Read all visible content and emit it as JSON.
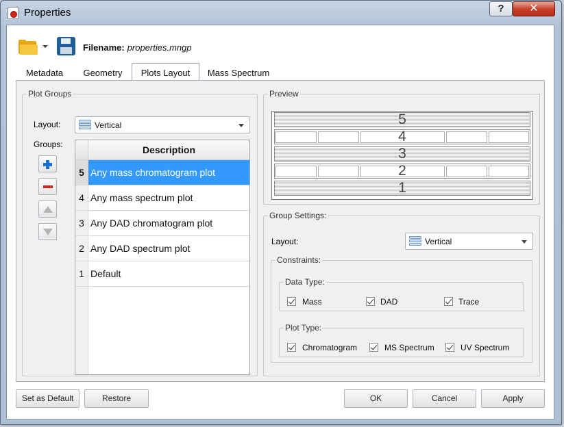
{
  "window": {
    "title": "Properties",
    "help_label": "?",
    "close_label": "✕"
  },
  "toolbar": {
    "open_icon": "folder-icon",
    "save_icon": "save-icon",
    "filename_label": "Filename:",
    "filename_value": "properties.mngp"
  },
  "tabs": [
    {
      "label": "Metadata"
    },
    {
      "label": "Geometry"
    },
    {
      "label": "Plots Layout",
      "active": true
    },
    {
      "label": "Mass Spectrum"
    }
  ],
  "plot_groups": {
    "title": "Plot Groups",
    "layout_label": "Layout:",
    "layout_value": "Vertical",
    "groups_label": "Groups:",
    "column_header": "Description",
    "rows": [
      {
        "index": "5",
        "description": "Any mass chromatogram plot",
        "selected": true
      },
      {
        "index": "4",
        "description": "Any mass spectrum plot"
      },
      {
        "index": "3",
        "description": "Any DAD chromatogram plot"
      },
      {
        "index": "2",
        "description": "Any DAD spectrum plot"
      },
      {
        "index": "1",
        "description": "Default"
      }
    ]
  },
  "preview": {
    "title": "Preview",
    "bands": [
      {
        "label": "5",
        "style": "lines"
      },
      {
        "label": "4",
        "style": "cells"
      },
      {
        "label": "3",
        "style": "lines"
      },
      {
        "label": "2",
        "style": "cells"
      },
      {
        "label": "1",
        "style": "lines"
      }
    ]
  },
  "group_settings": {
    "title": "Group Settings:",
    "layout_label": "Layout:",
    "layout_value": "Vertical",
    "constraints_title": "Constraints:",
    "data_type_title": "Data Type:",
    "data_types": [
      {
        "label": "Mass",
        "checked": true
      },
      {
        "label": "DAD",
        "checked": true
      },
      {
        "label": "Trace",
        "checked": true
      }
    ],
    "plot_type_title": "Plot Type:",
    "plot_types": [
      {
        "label": "Chromatogram",
        "checked": true
      },
      {
        "label": "MS Spectrum",
        "checked": true
      },
      {
        "label": "UV Spectrum",
        "checked": true
      }
    ]
  },
  "footer": {
    "set_default_label": "Set as Default",
    "restore_label": "Restore",
    "ok_label": "OK",
    "cancel_label": "Cancel",
    "apply_label": "Apply"
  }
}
